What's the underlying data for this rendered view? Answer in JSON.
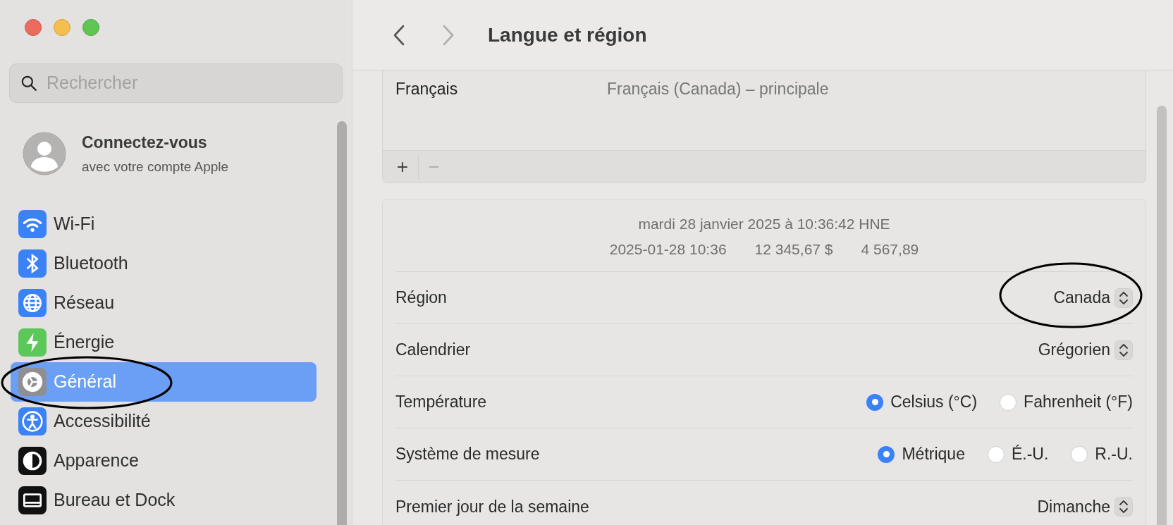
{
  "sidebar": {
    "search": {
      "placeholder": "Rechercher"
    },
    "account": {
      "title": "Connectez-vous",
      "subtitle": "avec votre compte Apple"
    },
    "items": [
      {
        "label": "Wi-Fi",
        "selected": false
      },
      {
        "label": "Bluetooth",
        "selected": false
      },
      {
        "label": "Réseau",
        "selected": false
      },
      {
        "label": "Énergie",
        "selected": false
      },
      {
        "label": "Général",
        "selected": true
      },
      {
        "label": "Accessibilité",
        "selected": false
      },
      {
        "label": "Apparence",
        "selected": false
      },
      {
        "label": "Bureau et Dock",
        "selected": false
      }
    ]
  },
  "toolbar": {
    "forward": {
      "disabled": true
    },
    "title": "Langue et région"
  },
  "languages": {
    "rows": [
      {
        "name": "Français",
        "detail": "Français (Canada) – principale"
      }
    ],
    "buttons": [
      {
        "label": "+",
        "disabled": false
      },
      {
        "label": "−",
        "disabled": true
      }
    ]
  },
  "preview": {
    "line_1": "mardi 28 janvier 2025 à 10:36:42 HNE",
    "line_2": [
      "2025-01-28 10:36",
      "12 345,67 $",
      "4 567,89"
    ]
  },
  "settings": [
    {
      "kind": "popup",
      "label": "Région",
      "value": "Canada"
    },
    {
      "kind": "popup",
      "label": "Calendrier",
      "value": "Grégorien"
    },
    {
      "kind": "radio",
      "label": "Température",
      "options": [
        {
          "label": "Celsius (°C)",
          "selected": true
        },
        {
          "label": "Fahrenheit (°F)",
          "selected": false
        }
      ]
    },
    {
      "kind": "radio",
      "label": "Système de mesure",
      "options": [
        {
          "label": "Métrique",
          "selected": true
        },
        {
          "label": "É.-U.",
          "selected": false
        },
        {
          "label": "R.-U.",
          "selected": false
        }
      ]
    },
    {
      "kind": "popup",
      "label": "Premier jour de la semaine",
      "value": "Dimanche"
    }
  ]
}
